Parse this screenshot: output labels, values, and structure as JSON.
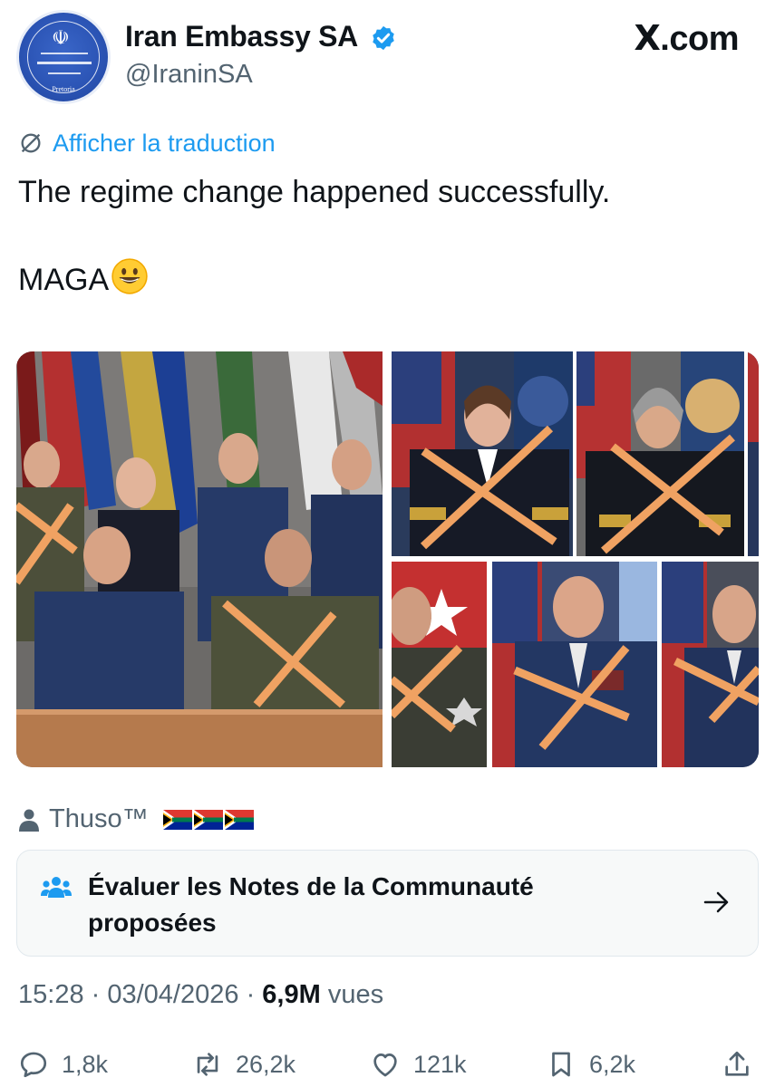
{
  "account": {
    "display_name": "Iran Embassy SA",
    "handle": "@IraninSA",
    "verified": true,
    "avatar_caption": "Pretoria"
  },
  "site_label": "X.com",
  "translate_label": "Afficher la traduction",
  "tweet": {
    "text": "The regime change happened successfully.\n\nMAGA",
    "emoji": "grinning-face"
  },
  "media": {
    "description_icons": [
      "group-photo",
      "official-portraits"
    ]
  },
  "note_author": {
    "name": "Thuso™",
    "flags": [
      "south-africa-flag",
      "south-africa-flag",
      "south-africa-flag"
    ]
  },
  "community_notes": {
    "label": "Évaluer les Notes de la Communauté proposées"
  },
  "meta": {
    "time": "15:28",
    "date": "03/04/2026",
    "views_count": "6,9M",
    "views_label": "vues",
    "separator": " · "
  },
  "actions": {
    "replies": "1,8k",
    "reposts": "26,2k",
    "likes": "121k",
    "bookmarks": "6,2k"
  },
  "colors": {
    "accent": "#1d9bf0",
    "cross": "#f0a262",
    "muted": "#536471"
  }
}
